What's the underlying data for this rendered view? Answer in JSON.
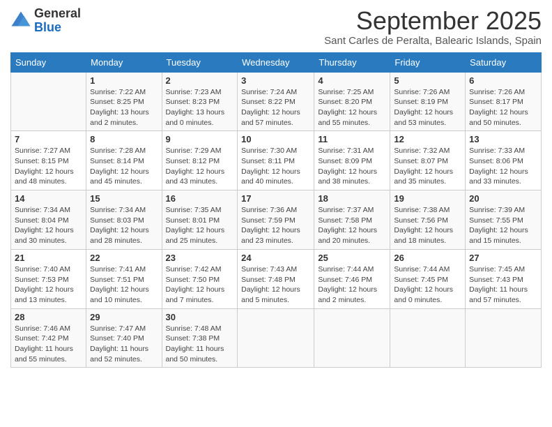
{
  "header": {
    "logo_general": "General",
    "logo_blue": "Blue",
    "month_title": "September 2025",
    "location": "Sant Carles de Peralta, Balearic Islands, Spain"
  },
  "weekdays": [
    "Sunday",
    "Monday",
    "Tuesday",
    "Wednesday",
    "Thursday",
    "Friday",
    "Saturday"
  ],
  "weeks": [
    [
      {
        "day": "",
        "sunrise": "",
        "sunset": "",
        "daylight": ""
      },
      {
        "day": "1",
        "sunrise": "Sunrise: 7:22 AM",
        "sunset": "Sunset: 8:25 PM",
        "daylight": "Daylight: 13 hours and 2 minutes."
      },
      {
        "day": "2",
        "sunrise": "Sunrise: 7:23 AM",
        "sunset": "Sunset: 8:23 PM",
        "daylight": "Daylight: 13 hours and 0 minutes."
      },
      {
        "day": "3",
        "sunrise": "Sunrise: 7:24 AM",
        "sunset": "Sunset: 8:22 PM",
        "daylight": "Daylight: 12 hours and 57 minutes."
      },
      {
        "day": "4",
        "sunrise": "Sunrise: 7:25 AM",
        "sunset": "Sunset: 8:20 PM",
        "daylight": "Daylight: 12 hours and 55 minutes."
      },
      {
        "day": "5",
        "sunrise": "Sunrise: 7:26 AM",
        "sunset": "Sunset: 8:19 PM",
        "daylight": "Daylight: 12 hours and 53 minutes."
      },
      {
        "day": "6",
        "sunrise": "Sunrise: 7:26 AM",
        "sunset": "Sunset: 8:17 PM",
        "daylight": "Daylight: 12 hours and 50 minutes."
      }
    ],
    [
      {
        "day": "7",
        "sunrise": "Sunrise: 7:27 AM",
        "sunset": "Sunset: 8:15 PM",
        "daylight": "Daylight: 12 hours and 48 minutes."
      },
      {
        "day": "8",
        "sunrise": "Sunrise: 7:28 AM",
        "sunset": "Sunset: 8:14 PM",
        "daylight": "Daylight: 12 hours and 45 minutes."
      },
      {
        "day": "9",
        "sunrise": "Sunrise: 7:29 AM",
        "sunset": "Sunset: 8:12 PM",
        "daylight": "Daylight: 12 hours and 43 minutes."
      },
      {
        "day": "10",
        "sunrise": "Sunrise: 7:30 AM",
        "sunset": "Sunset: 8:11 PM",
        "daylight": "Daylight: 12 hours and 40 minutes."
      },
      {
        "day": "11",
        "sunrise": "Sunrise: 7:31 AM",
        "sunset": "Sunset: 8:09 PM",
        "daylight": "Daylight: 12 hours and 38 minutes."
      },
      {
        "day": "12",
        "sunrise": "Sunrise: 7:32 AM",
        "sunset": "Sunset: 8:07 PM",
        "daylight": "Daylight: 12 hours and 35 minutes."
      },
      {
        "day": "13",
        "sunrise": "Sunrise: 7:33 AM",
        "sunset": "Sunset: 8:06 PM",
        "daylight": "Daylight: 12 hours and 33 minutes."
      }
    ],
    [
      {
        "day": "14",
        "sunrise": "Sunrise: 7:34 AM",
        "sunset": "Sunset: 8:04 PM",
        "daylight": "Daylight: 12 hours and 30 minutes."
      },
      {
        "day": "15",
        "sunrise": "Sunrise: 7:34 AM",
        "sunset": "Sunset: 8:03 PM",
        "daylight": "Daylight: 12 hours and 28 minutes."
      },
      {
        "day": "16",
        "sunrise": "Sunrise: 7:35 AM",
        "sunset": "Sunset: 8:01 PM",
        "daylight": "Daylight: 12 hours and 25 minutes."
      },
      {
        "day": "17",
        "sunrise": "Sunrise: 7:36 AM",
        "sunset": "Sunset: 7:59 PM",
        "daylight": "Daylight: 12 hours and 23 minutes."
      },
      {
        "day": "18",
        "sunrise": "Sunrise: 7:37 AM",
        "sunset": "Sunset: 7:58 PM",
        "daylight": "Daylight: 12 hours and 20 minutes."
      },
      {
        "day": "19",
        "sunrise": "Sunrise: 7:38 AM",
        "sunset": "Sunset: 7:56 PM",
        "daylight": "Daylight: 12 hours and 18 minutes."
      },
      {
        "day": "20",
        "sunrise": "Sunrise: 7:39 AM",
        "sunset": "Sunset: 7:55 PM",
        "daylight": "Daylight: 12 hours and 15 minutes."
      }
    ],
    [
      {
        "day": "21",
        "sunrise": "Sunrise: 7:40 AM",
        "sunset": "Sunset: 7:53 PM",
        "daylight": "Daylight: 12 hours and 13 minutes."
      },
      {
        "day": "22",
        "sunrise": "Sunrise: 7:41 AM",
        "sunset": "Sunset: 7:51 PM",
        "daylight": "Daylight: 12 hours and 10 minutes."
      },
      {
        "day": "23",
        "sunrise": "Sunrise: 7:42 AM",
        "sunset": "Sunset: 7:50 PM",
        "daylight": "Daylight: 12 hours and 7 minutes."
      },
      {
        "day": "24",
        "sunrise": "Sunrise: 7:43 AM",
        "sunset": "Sunset: 7:48 PM",
        "daylight": "Daylight: 12 hours and 5 minutes."
      },
      {
        "day": "25",
        "sunrise": "Sunrise: 7:44 AM",
        "sunset": "Sunset: 7:46 PM",
        "daylight": "Daylight: 12 hours and 2 minutes."
      },
      {
        "day": "26",
        "sunrise": "Sunrise: 7:44 AM",
        "sunset": "Sunset: 7:45 PM",
        "daylight": "Daylight: 12 hours and 0 minutes."
      },
      {
        "day": "27",
        "sunrise": "Sunrise: 7:45 AM",
        "sunset": "Sunset: 7:43 PM",
        "daylight": "Daylight: 11 hours and 57 minutes."
      }
    ],
    [
      {
        "day": "28",
        "sunrise": "Sunrise: 7:46 AM",
        "sunset": "Sunset: 7:42 PM",
        "daylight": "Daylight: 11 hours and 55 minutes."
      },
      {
        "day": "29",
        "sunrise": "Sunrise: 7:47 AM",
        "sunset": "Sunset: 7:40 PM",
        "daylight": "Daylight: 11 hours and 52 minutes."
      },
      {
        "day": "30",
        "sunrise": "Sunrise: 7:48 AM",
        "sunset": "Sunset: 7:38 PM",
        "daylight": "Daylight: 11 hours and 50 minutes."
      },
      {
        "day": "",
        "sunrise": "",
        "sunset": "",
        "daylight": ""
      },
      {
        "day": "",
        "sunrise": "",
        "sunset": "",
        "daylight": ""
      },
      {
        "day": "",
        "sunrise": "",
        "sunset": "",
        "daylight": ""
      },
      {
        "day": "",
        "sunrise": "",
        "sunset": "",
        "daylight": ""
      }
    ]
  ]
}
